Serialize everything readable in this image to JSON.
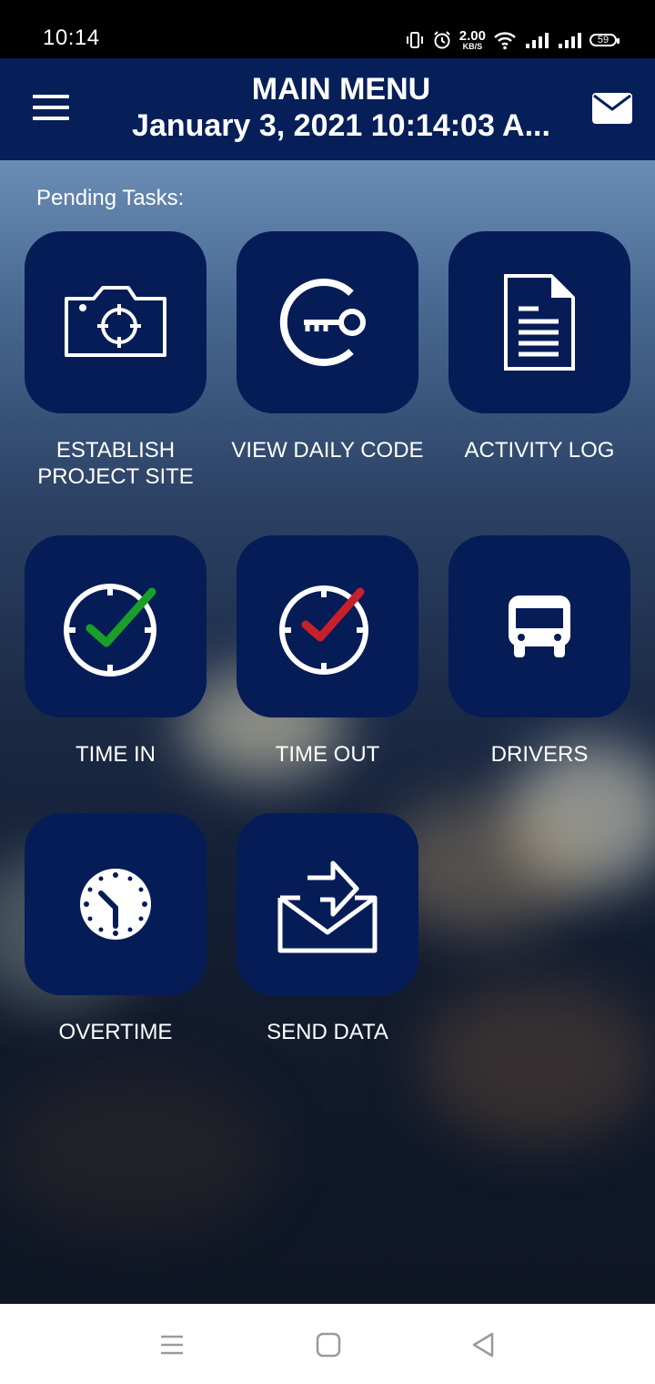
{
  "status_bar": {
    "time": "10:14",
    "net_speed_value": "2.00",
    "net_speed_unit": "KB/S",
    "battery": "59"
  },
  "app_bar": {
    "title": "MAIN MENU",
    "subtitle": "January 3, 2021 10:14:03 A...",
    "menu_icon": "hamburger-icon",
    "mail_icon": "envelope-icon"
  },
  "main": {
    "pending_label": "Pending Tasks:",
    "tiles": [
      {
        "label": "ESTABLISH PROJECT SITE",
        "icon": "camera-icon"
      },
      {
        "label": "VIEW DAILY CODE",
        "icon": "key-icon"
      },
      {
        "label": "ACTIVITY LOG",
        "icon": "document-icon"
      },
      {
        "label": "TIME IN",
        "icon": "clock-green-check-icon"
      },
      {
        "label": "TIME OUT",
        "icon": "clock-red-check-icon"
      },
      {
        "label": "DRIVERS",
        "icon": "bus-icon"
      },
      {
        "label": "OVERTIME",
        "icon": "clock-icon"
      },
      {
        "label": "SEND DATA",
        "icon": "send-mail-icon"
      }
    ]
  },
  "colors": {
    "app_bar": "#061f59",
    "tile": "#051c57",
    "time_in_check": "#1a9e2a",
    "time_out_check": "#c8202a"
  },
  "nav_bar": {
    "icons": [
      "recents-icon",
      "home-icon",
      "back-icon"
    ]
  }
}
